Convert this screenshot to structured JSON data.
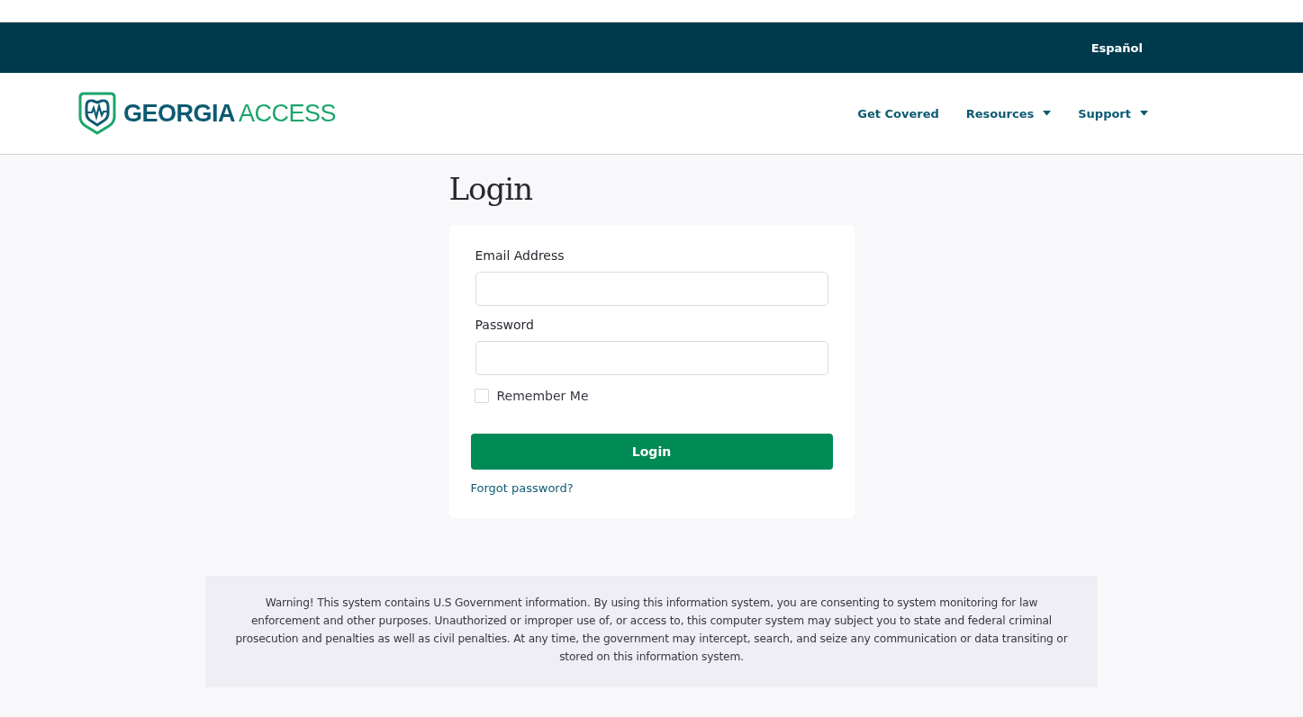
{
  "topbar": {
    "language_link": "Español"
  },
  "logo": {
    "word_1": "GEORGIA",
    "word_2": "ACCESS"
  },
  "nav": [
    {
      "label": "Get Covered",
      "dropdown": false
    },
    {
      "label": "Resources",
      "dropdown": true
    },
    {
      "label": "Support",
      "dropdown": true
    }
  ],
  "page_title": "Login",
  "form": {
    "email_label": "Email Address",
    "password_label": "Password",
    "remember_me": {
      "label": "Remember Me",
      "checked": false
    },
    "submit": "Login",
    "forgot_link": "Forgot password?"
  },
  "warning": "Warning! This system contains U.S Government information. By using this information system, you are consenting to system monitoring for law enforcement and other purposes. Unauthorized or improper use of, or access to, this computer system may subject you to state and federal criminal prosecution and penalties as well as civil penalties. At any time, the government may intercept, search, and seize any communication or data transiting or stored on this information system."
}
